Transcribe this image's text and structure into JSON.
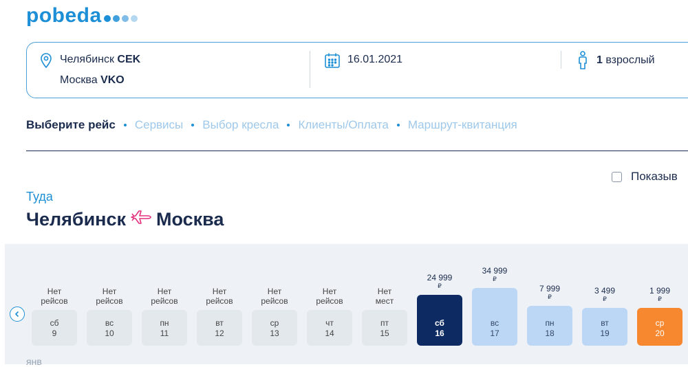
{
  "logo": {
    "text": "pobeda",
    "dot_colors": [
      "#1d8fd6",
      "#3fa0dd",
      "#7fbde8",
      "#b5d8f1"
    ]
  },
  "search": {
    "from_city": "Челябинск",
    "from_code": "CEK",
    "to_city": "Москва",
    "to_code": "VKO",
    "date": "16.01.2021",
    "passengers_count": "1",
    "passengers_label": "взрослый"
  },
  "steps": [
    "Выберите рейс",
    "Сервисы",
    "Выбор кресла",
    "Клиенты/Оплата",
    "Маршрут-квитанция"
  ],
  "filter": {
    "label": "Показыв"
  },
  "flight": {
    "direction": "Туда",
    "from": "Челябинск",
    "to": "Москва"
  },
  "calendar": {
    "currency": "₽",
    "month_label": "янв",
    "days": [
      {
        "note": [
          "Нет",
          "рейсов"
        ],
        "price": null,
        "weekday": "сб",
        "day": "9",
        "state": "none",
        "level": 0
      },
      {
        "note": [
          "Нет",
          "рейсов"
        ],
        "price": null,
        "weekday": "вс",
        "day": "10",
        "state": "none",
        "level": 0
      },
      {
        "note": [
          "Нет",
          "рейсов"
        ],
        "price": null,
        "weekday": "пн",
        "day": "11",
        "state": "none",
        "level": 0
      },
      {
        "note": [
          "Нет",
          "рейсов"
        ],
        "price": null,
        "weekday": "вт",
        "day": "12",
        "state": "none",
        "level": 0
      },
      {
        "note": [
          "Нет",
          "рейсов"
        ],
        "price": null,
        "weekday": "ср",
        "day": "13",
        "state": "none",
        "level": 0
      },
      {
        "note": [
          "Нет",
          "рейсов"
        ],
        "price": null,
        "weekday": "чт",
        "day": "14",
        "state": "none",
        "level": 0
      },
      {
        "note": [
          "Нет",
          "мест"
        ],
        "price": null,
        "weekday": "пт",
        "day": "15",
        "state": "none",
        "level": 0
      },
      {
        "note": null,
        "price": "24 999",
        "weekday": "сб",
        "day": "16",
        "state": "selected",
        "level": 0.73
      },
      {
        "note": null,
        "price": "34 999",
        "weekday": "вс",
        "day": "17",
        "state": "available",
        "level": 1.0
      },
      {
        "note": null,
        "price": "7 999",
        "weekday": "пн",
        "day": "18",
        "state": "available",
        "level": 0.59
      },
      {
        "note": null,
        "price": "3 499",
        "weekday": "вт",
        "day": "19",
        "state": "available",
        "level": 0.55
      },
      {
        "note": null,
        "price": "1 999",
        "weekday": "ср",
        "day": "20",
        "state": "cheapest",
        "level": 0.54
      }
    ]
  },
  "colors": {
    "brand": "#1d8fd6",
    "dark": "#1b2b4d",
    "selected": "#0d2a63",
    "available": "#bcd7f5",
    "cheapest": "#f7882f",
    "empty": "#e3e8ed"
  }
}
